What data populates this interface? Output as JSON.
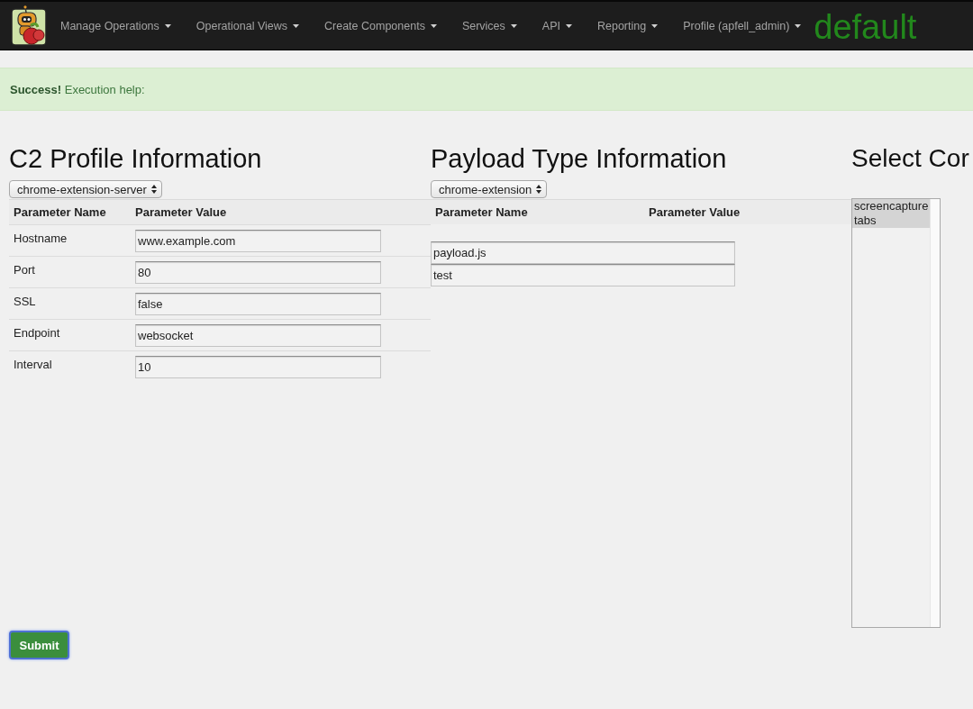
{
  "navbar": {
    "menus": [
      {
        "label": "Manage Operations"
      },
      {
        "label": "Operational Views"
      },
      {
        "label": "Create Components"
      },
      {
        "label": "Services"
      },
      {
        "label": "API"
      },
      {
        "label": "Reporting"
      },
      {
        "label": "Profile (apfell_admin)"
      }
    ],
    "operation": "default"
  },
  "alert": {
    "message": "**Success!** Execution help:"
  },
  "c2_profile": {
    "title": "C2 Profile Information",
    "select": "chrome-extension-server",
    "columns": [
      "Parameter Name",
      "Parameter Value"
    ],
    "rows": [
      {
        "name": "Hostname",
        "value": "www.example.com"
      },
      {
        "name": "Port",
        "value": "80"
      },
      {
        "name": "SSL",
        "value": "false"
      },
      {
        "name": "Endpoint",
        "value": "websocket"
      },
      {
        "name": "Interval",
        "value": "10"
      }
    ]
  },
  "payload_type": {
    "title": "Payload Type Information",
    "select": "chrome-extension",
    "columns": [
      "Parameter Name",
      "Parameter Value"
    ],
    "fields": [
      {
        "value": "payload.js"
      },
      {
        "value": "test"
      }
    ]
  },
  "commands": {
    "title": "Select Cor",
    "items": [
      {
        "label": "screencapture",
        "selected": true
      },
      {
        "label": "tabs",
        "selected": true
      }
    ]
  },
  "submit": "Submit"
}
